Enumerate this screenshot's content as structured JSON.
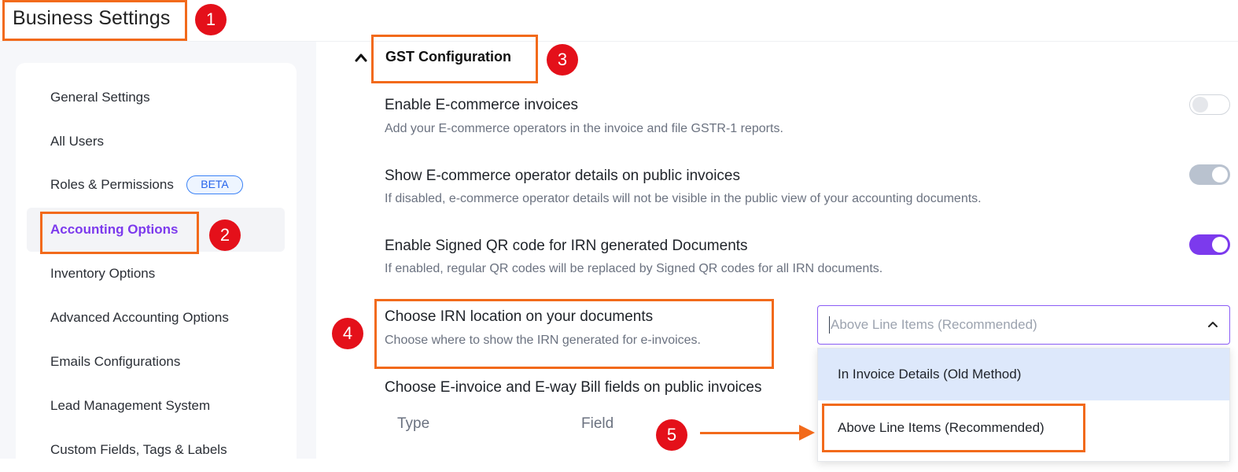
{
  "page": {
    "title": "Business Settings"
  },
  "sidebar": {
    "items": [
      {
        "label": "General Settings"
      },
      {
        "label": "All Users"
      },
      {
        "label": "Roles & Permissions",
        "badge": "BETA"
      },
      {
        "label": "Accounting Options",
        "active": true
      },
      {
        "label": "Inventory Options"
      },
      {
        "label": "Advanced Accounting Options"
      },
      {
        "label": "Emails Configurations"
      },
      {
        "label": "Lead Management System"
      },
      {
        "label": "Custom Fields, Tags & Labels"
      }
    ]
  },
  "section": {
    "title": "GST Configuration",
    "expanded": true,
    "settings": [
      {
        "title": "Enable E-commerce invoices",
        "description": "Add your E-commerce operators in the invoice and file GSTR-1 reports.",
        "toggle": "off"
      },
      {
        "title": "Show E-commerce operator details on public invoices",
        "description": "If disabled, e-commerce operator details will not be visible in the public view of your accounting documents.",
        "toggle": "on-disabled"
      },
      {
        "title": "Enable Signed QR code for IRN generated Documents",
        "description": "If enabled, regular QR codes will be replaced by Signed QR codes for all IRN documents.",
        "toggle": "on"
      }
    ],
    "irn_location": {
      "title": "Choose IRN location on your documents",
      "description": "Choose where to show the IRN generated for e-invoices.",
      "placeholder": "Above Line Items (Recommended)",
      "options": [
        "In Invoice Details (Old Method)",
        "Above Line Items (Recommended)"
      ]
    },
    "public_fields": {
      "title": "Choose E-invoice and E-way Bill fields on public invoices",
      "columns": [
        "Type",
        "Field"
      ]
    }
  },
  "annotations": [
    "1",
    "2",
    "3",
    "4",
    "5"
  ],
  "colors": {
    "accent": "#7c3aed",
    "annotation": "#f26a1b",
    "badge": "#e4101a"
  }
}
